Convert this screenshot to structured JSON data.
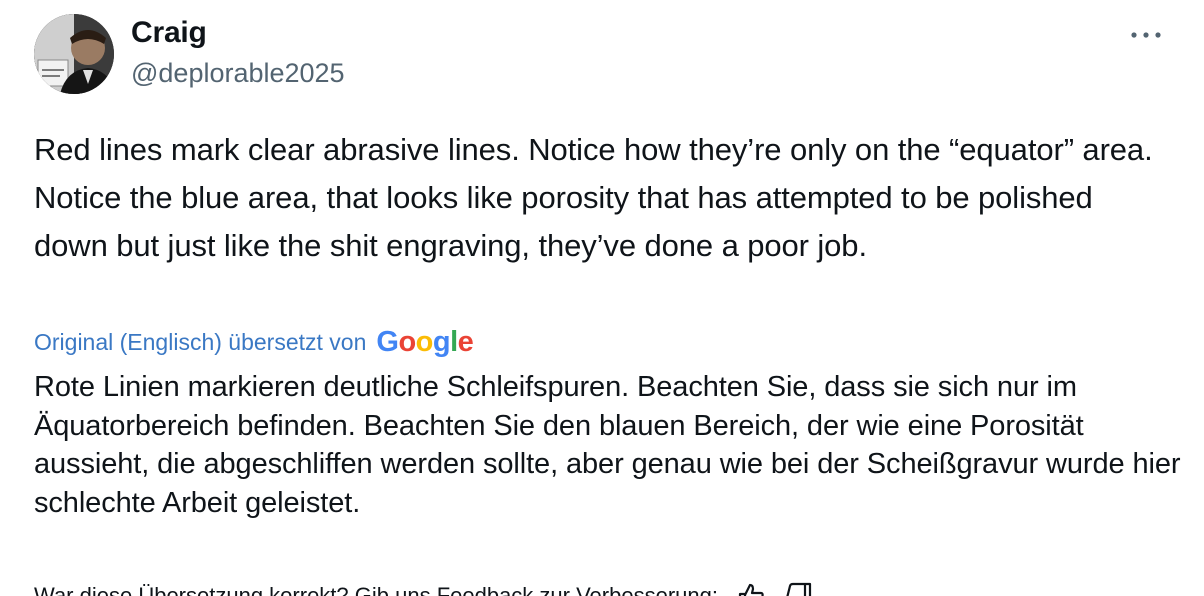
{
  "author": {
    "display_name": "Craig",
    "handle": "@deplorable2025"
  },
  "tweet": {
    "text": "Red lines mark clear abrasive lines. Notice how they’re only on the “equator” area. Notice the blue area, that looks like porosity that has attempted to be polished down but just like the shit engraving, they’ve done a poor job."
  },
  "translation": {
    "label": "Original (Englisch) übersetzt von",
    "provider": [
      "G",
      "o",
      "o",
      "g",
      "l",
      "e"
    ],
    "text": "Rote Linien markieren deutliche Schleifspuren. Beachten Sie, dass sie sich nur im Äquatorbereich befinden. Beachten Sie den blauen Bereich, der wie eine Porosität aussieht, die abgeschliffen werden sollte, aber genau wie bei der Scheißgravur wurde hier schlechte Arbeit geleistet.",
    "feedback_prompt": "War diese Übersetzung korrekt? Gib uns Feedback zur Verbesserung:"
  },
  "icons": {
    "more": "more-horizontal-icon",
    "thumbs_up": "thumbs-up-icon",
    "thumbs_down": "thumbs-down-icon"
  },
  "colors": {
    "link": "#3a78c4",
    "secondary_text": "#536471",
    "primary_text": "#0f1419"
  }
}
